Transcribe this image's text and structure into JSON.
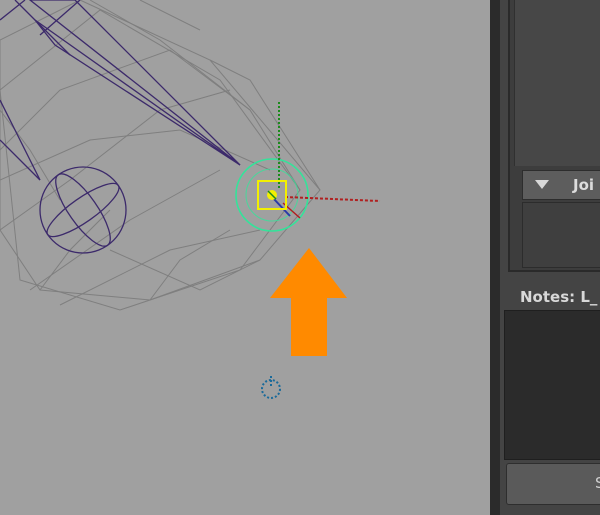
{
  "panel": {
    "section_header": "Joi",
    "notes_label": "Notes: L_",
    "button_label": "S"
  },
  "viewport": {
    "icons": [
      "orange-arrow-up-icon",
      "move-manipulator-icon",
      "pivot-marker-icon"
    ]
  },
  "colors": {
    "viewport_bg": "#a0a0a0",
    "panel_bg": "#444444",
    "wire_gray": "#7f7f7f",
    "wire_joint": "#3c2a6b",
    "selection_green": "#34e39a",
    "selection_yellow": "#f3f000",
    "axis_red": "#b02020",
    "axis_green": "#1c8a1c",
    "axis_blue": "#2a3aa8",
    "arrow_orange": "#ff8a00",
    "pivot_blue": "#1a6a9a"
  }
}
